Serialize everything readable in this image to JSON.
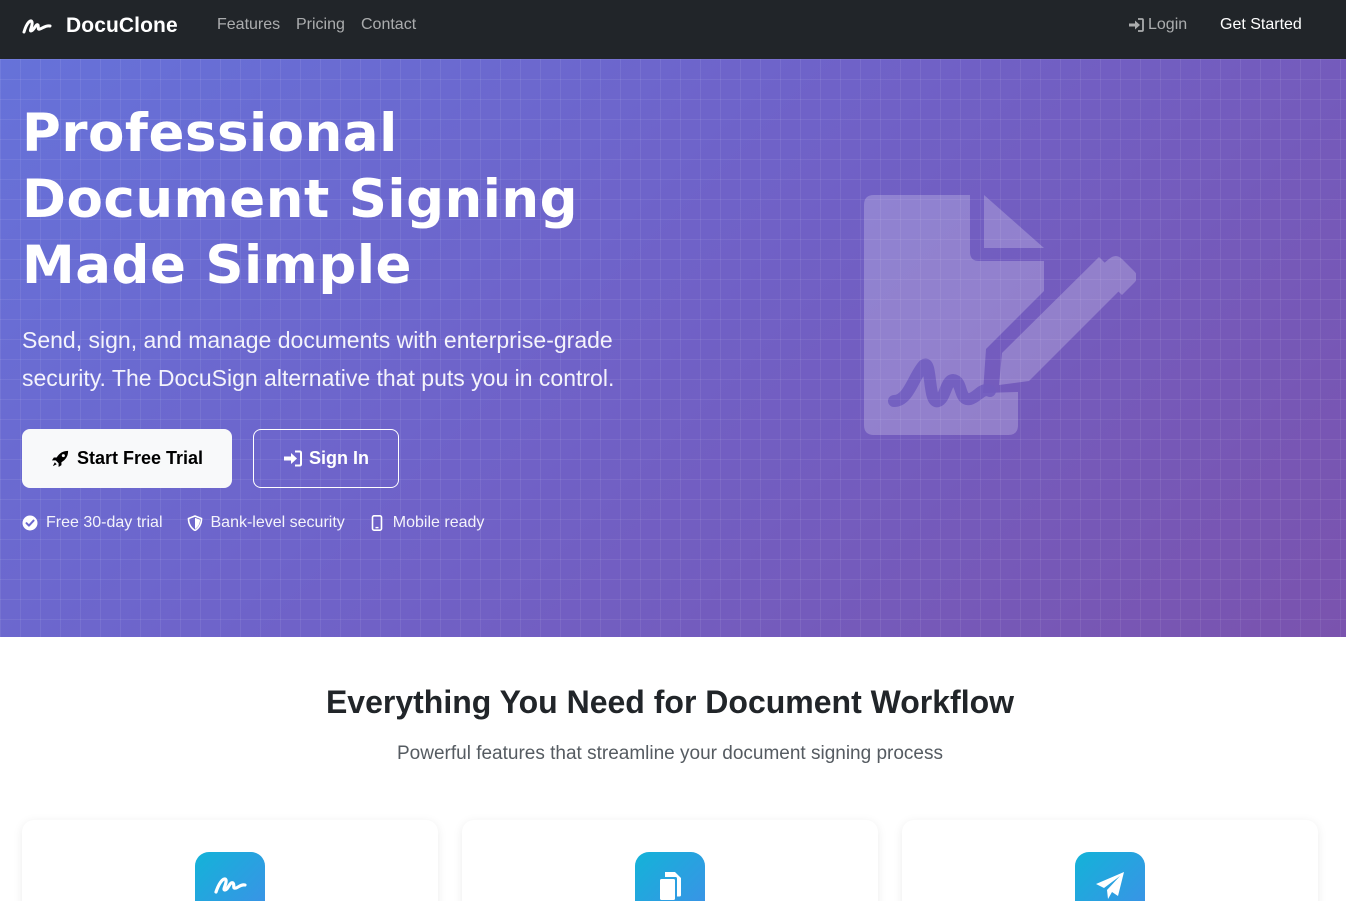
{
  "navbar": {
    "brand": "DocuClone",
    "brand_icon": "signature-icon",
    "links": [
      "Features",
      "Pricing",
      "Contact"
    ],
    "login": "Login",
    "get_started": "Get Started"
  },
  "hero": {
    "title": "Professional Document Signing Made Simple",
    "subtitle": "Send, sign, and manage documents with enterprise-grade security. The DocuSign alternative that puts you in control.",
    "primary_button": "Start Free Trial",
    "secondary_button": "Sign In",
    "badges": [
      "Free 30-day trial",
      "Bank-level security",
      "Mobile ready"
    ],
    "art_icon": "file-signature-icon"
  },
  "features": {
    "title": "Everything You Need for Document Workflow",
    "subtitle": "Powerful features that streamline your document signing process",
    "card_icons": [
      "signature-icon",
      "copy-icon",
      "paper-plane-icon"
    ]
  },
  "colors": {
    "navbar_bg": "#212529",
    "hero_gradient_start": "#6672d9",
    "hero_gradient_end": "#7a53ae",
    "card_icon_gradient_start": "#13b3d8",
    "card_icon_gradient_end": "#3f8fe8"
  }
}
